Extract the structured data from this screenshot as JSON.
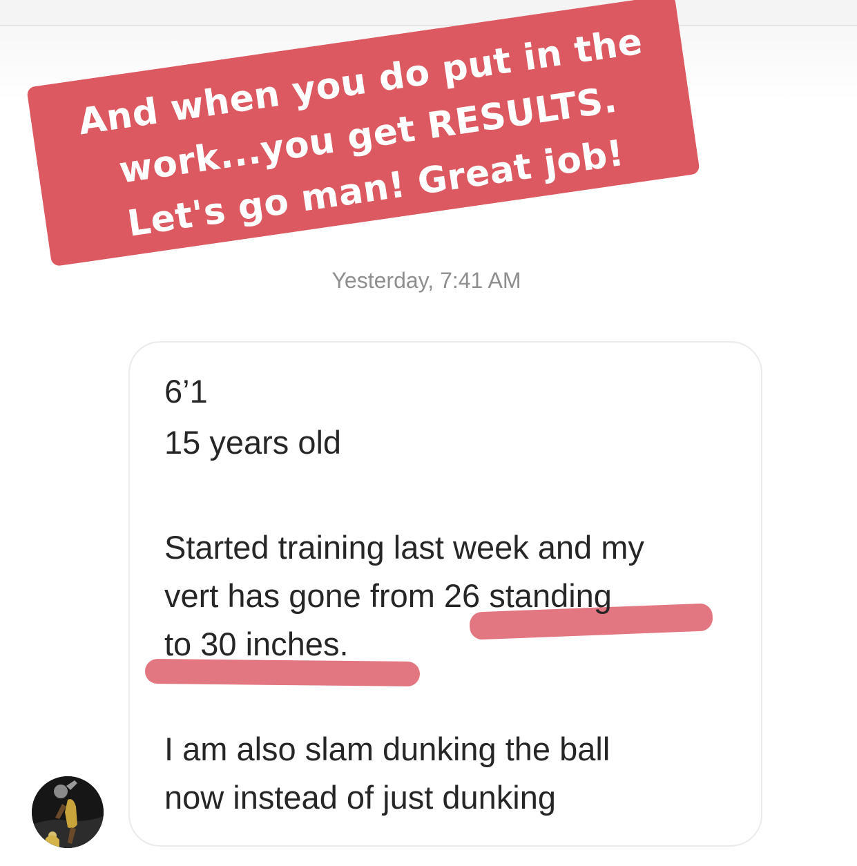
{
  "story_caption": {
    "lines": [
      "And when you do put in the",
      "work...you get RESULTS.",
      "Let's go man! Great job!"
    ],
    "background_color": "#dc5961"
  },
  "timestamp": "Yesterday, 7:41 AM",
  "message": {
    "height_line": "6’1",
    "age_line": "15 years old",
    "training_lines": [
      "Started training last week and my",
      "vert has gone from 26 standing",
      "to 30 inches."
    ],
    "dunk_lines": [
      "I am also slam dunking the ball",
      "now instead of just dunking"
    ],
    "highlight_color": "#e0707a"
  },
  "sender": {
    "avatar_icon": "basketball-player-avatar"
  }
}
